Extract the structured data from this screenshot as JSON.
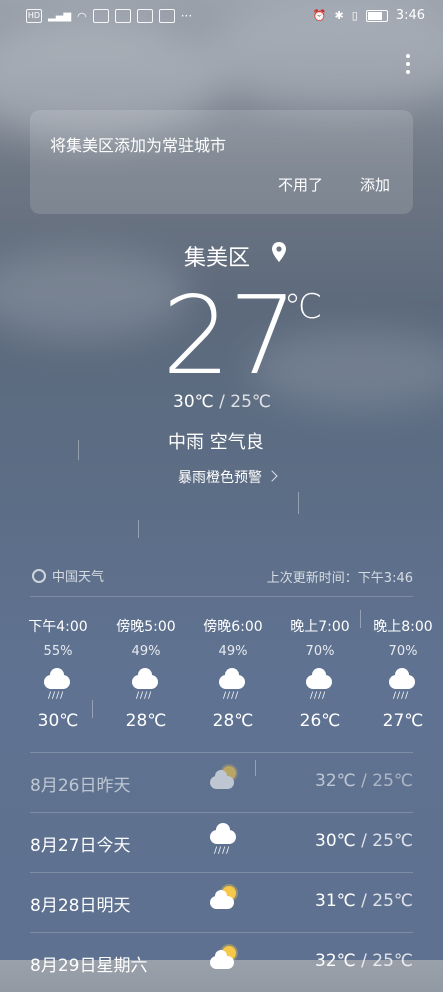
{
  "status_bar": {
    "left_badges": [
      "HD",
      "46"
    ],
    "time": "3:46"
  },
  "prompt": {
    "message": "将集美区添加为常驻城市",
    "dismiss_label": "不用了",
    "add_label": "添加"
  },
  "current": {
    "city": "集美区",
    "temp": "27",
    "unit": "℃",
    "high": "30℃",
    "sep_low": " / 25℃",
    "condition": "中雨  空气良",
    "alert": "暴雨橙色预警"
  },
  "source": {
    "provider": "中国天气",
    "updated": "上次更新时间：下午3:46"
  },
  "hourly": [
    {
      "time": "下午4:00",
      "precip": "55%",
      "temp": "30℃",
      "icon": "rain-icon"
    },
    {
      "time": "傍晚5:00",
      "precip": "49%",
      "temp": "28℃",
      "icon": "rain-icon"
    },
    {
      "time": "傍晚6:00",
      "precip": "49%",
      "temp": "28℃",
      "icon": "rain-icon"
    },
    {
      "time": "晚上7:00",
      "precip": "70%",
      "temp": "26℃",
      "icon": "rain-icon"
    },
    {
      "time": "晚上8:00",
      "precip": "70%",
      "temp": "27℃",
      "icon": "rain-icon"
    }
  ],
  "daily": [
    {
      "date": "8月26日昨天",
      "high": "32℃",
      "low": " / 25℃",
      "icon": "partly-sunny-icon"
    },
    {
      "date": "8月27日今天",
      "high": "30℃",
      "low": " / 25℃",
      "icon": "rain-icon"
    },
    {
      "date": "8月28日明天",
      "high": "31℃",
      "low": " / 25℃",
      "icon": "partly-sunny-icon"
    },
    {
      "date": "8月29日星期六",
      "high": "32℃",
      "low": " / 25℃",
      "icon": "partly-sunny-icon"
    }
  ]
}
